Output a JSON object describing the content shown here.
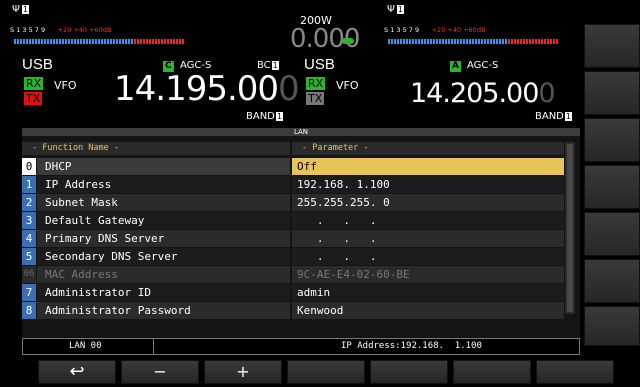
{
  "power": "200W",
  "left": {
    "meter_scale": "S 1 3 5 7 9",
    "meter_scale_red": "+20  +40 +60dB",
    "mode": "USB",
    "rx": "RX",
    "tx": "TX",
    "vfo": "VFO",
    "agc_badge": "C",
    "agc": "AGC-S",
    "bc": "BC",
    "bc_num": "1",
    "freq": "14.195.00",
    "freq_last": "0",
    "band": "BAND",
    "band_num": "1"
  },
  "center_freq": "0.000",
  "right": {
    "meter_scale": "S 1 3 5 7 9",
    "meter_scale_red": "+20  +40 +60dB",
    "mode": "USB",
    "rx": "RX",
    "tx": "TX",
    "vfo": "VFO",
    "agc_badge": "A",
    "agc": "AGC-S",
    "freq": "14.205.00",
    "freq_last": "0",
    "band": "BAND",
    "band_num": "1"
  },
  "window": {
    "title": "LAN",
    "col_function": "- Function Name -",
    "col_parameter": "- Parameter -",
    "rows": [
      {
        "idx": "0",
        "name": "DHCP",
        "value": "Off"
      },
      {
        "idx": "1",
        "name": "IP Address",
        "value": "192.168.  1.100"
      },
      {
        "idx": "2",
        "name": "Subnet Mask",
        "value": "255.255.255.  0"
      },
      {
        "idx": "3",
        "name": "Default Gateway",
        "value": "   .   .   .  "
      },
      {
        "idx": "4",
        "name": "Primary DNS Server",
        "value": "   .   .   .  "
      },
      {
        "idx": "5",
        "name": "Secondary DNS Server",
        "value": "   .   .   .  "
      },
      {
        "idx": "06",
        "name": "MAC Address",
        "value": "9C-AE-E4-02-60-BE"
      },
      {
        "idx": "7",
        "name": "Administrator ID",
        "value": "admin"
      },
      {
        "idx": "8",
        "name": "Administrator Password",
        "value": "Kenwood"
      }
    ]
  },
  "status": {
    "left": "LAN 00",
    "right": "IP Address:192.168.  1.100"
  },
  "keys": {
    "back": "↩",
    "minus": "−",
    "plus": "+"
  },
  "colors": {
    "selected_row": "#e8c458",
    "index_bg": "#3a6fb0",
    "rx_green": "#2bb52b",
    "tx_red": "#e01010"
  }
}
